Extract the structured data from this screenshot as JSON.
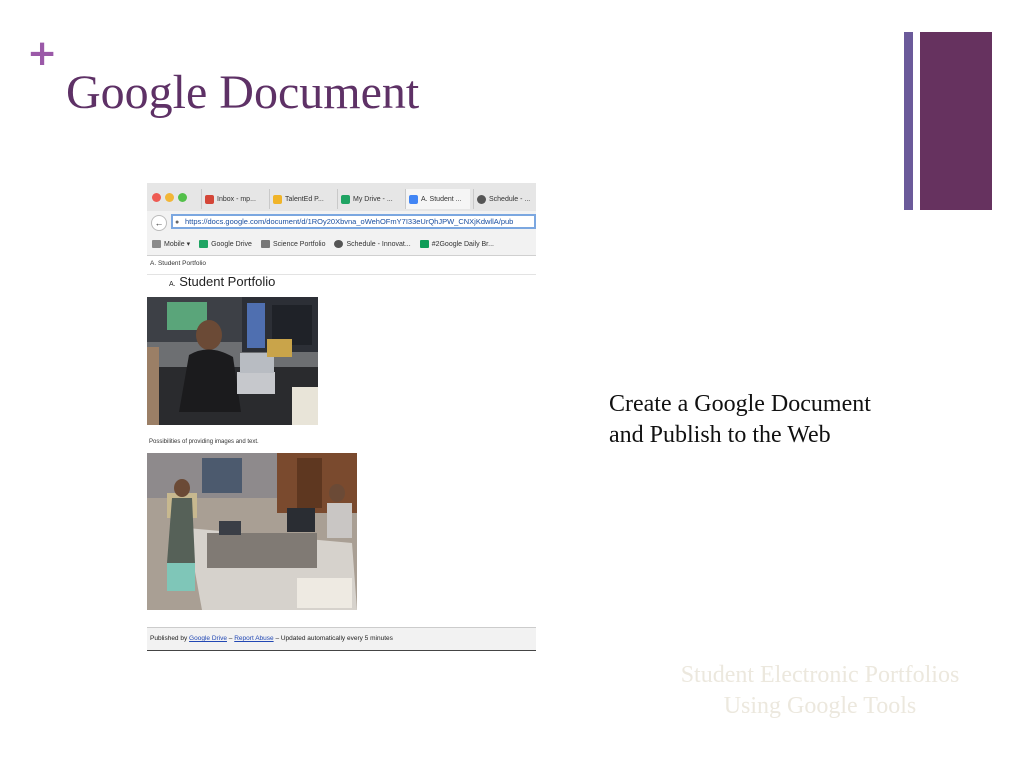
{
  "slide": {
    "plus": "+",
    "title": "Google Document",
    "description_line1": "Create a Google Document",
    "description_line2": "and Publish to the Web",
    "watermark_line1": "Student Electronic Portfolios",
    "watermark_line2": "Using Google Tools",
    "accent_colors": {
      "title": "#5e3166",
      "bar_thin": "#6b5a9a",
      "bar_thick": "#66325f",
      "plus": "#9b59a8"
    }
  },
  "browser": {
    "tabs": [
      {
        "label": "Inbox - mp...",
        "icon": "gmail-icon"
      },
      {
        "label": "TalentEd P...",
        "icon": "crown-icon"
      },
      {
        "label": "My Drive - ...",
        "icon": "drive-icon"
      },
      {
        "label": "A. Student ...",
        "icon": "docs-icon"
      },
      {
        "label": "Schedule - ...",
        "icon": "schedule-icon"
      }
    ],
    "url": "https://docs.google.com/document/d/1ROy20Xbvna_oWehOFmY7I33eUrQhJPW_CNXjKdwllA/pub",
    "bookmarks": [
      {
        "label": "Mobile ▾",
        "icon": "folder-icon"
      },
      {
        "label": "Google Drive",
        "icon": "drive-icon"
      },
      {
        "label": "Science Portfolio",
        "icon": "bookmark-icon"
      },
      {
        "label": "Schedule - Innovat...",
        "icon": "schedule-icon"
      },
      {
        "label": "#2Google Daily Br...",
        "icon": "sheets-icon"
      }
    ]
  },
  "published_doc": {
    "path": "A. Student Portfolio",
    "title_prefix": "A.",
    "title": "Student Portfolio",
    "caption": "Possibilities of providing images and text.",
    "footer_prefix": "Published by",
    "footer_link1": "Google Drive",
    "footer_sep": "–",
    "footer_link2": "Report Abuse",
    "footer_suffix": "– Updated automatically every 5 minutes"
  }
}
